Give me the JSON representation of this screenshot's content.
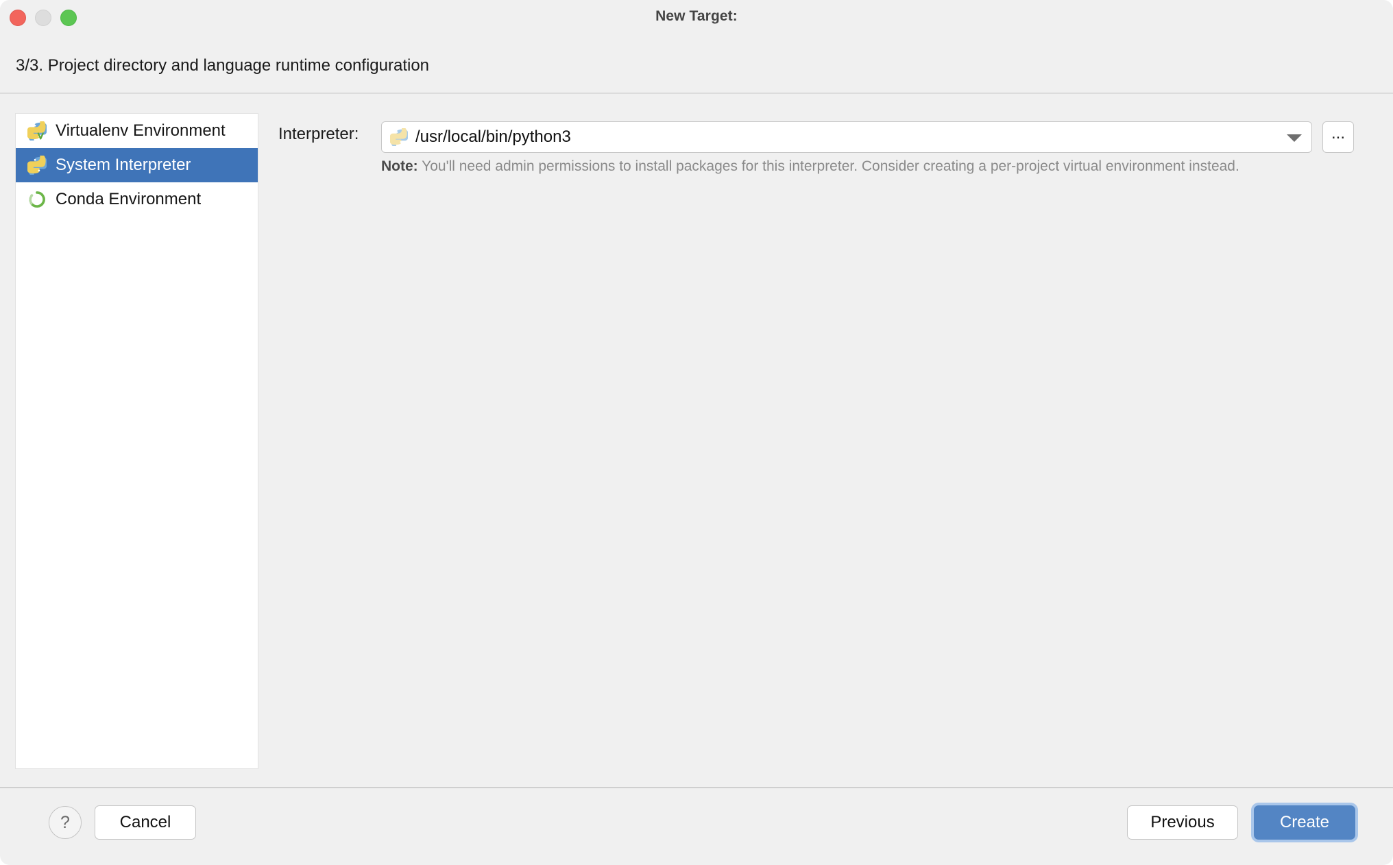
{
  "window": {
    "title": "New Target:",
    "traffic_lights": [
      "close-button",
      "minimize-button",
      "maximize-button"
    ]
  },
  "header": {
    "step_title": "3/3. Project directory and language runtime configuration"
  },
  "sidebar": {
    "items": [
      {
        "label": "Virtualenv Environment",
        "icon": "python-virtualenv-icon",
        "selected": false
      },
      {
        "label": "System Interpreter",
        "icon": "python-icon",
        "selected": true
      },
      {
        "label": "Conda Environment",
        "icon": "conda-icon",
        "selected": false
      }
    ]
  },
  "main": {
    "interpreter_label": "Interpreter:",
    "interpreter_value": "/usr/local/bin/python3",
    "interpreter_icon": "python-icon",
    "browse_label": "...",
    "note_prefix": "Note:",
    "note_text": "You'll need admin permissions to install packages for this interpreter. Consider creating a per-project virtual environment instead."
  },
  "footer": {
    "help_label": "?",
    "cancel_label": "Cancel",
    "previous_label": "Previous",
    "create_label": "Create"
  },
  "colors": {
    "selection_blue": "#3f74b8",
    "primary_button": "#5385c4",
    "focus_ring": "#a9c6ea",
    "window_bg": "#f0f0f0"
  }
}
